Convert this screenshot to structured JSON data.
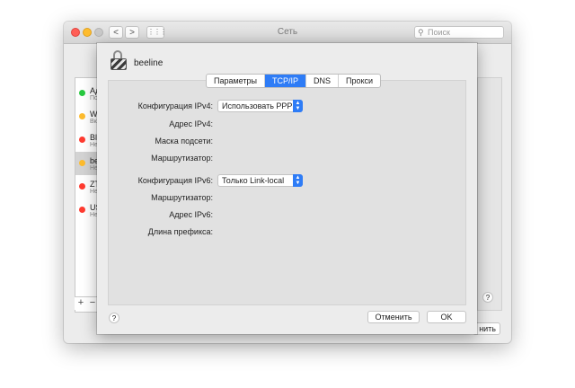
{
  "window": {
    "title": "Сеть",
    "search_placeholder": "Поиск",
    "back_glyph": "<",
    "forward_glyph": ">",
    "grid_glyph": "⋮⋮⋮",
    "help_glyph": "?",
    "apply_fragment": "нить"
  },
  "sidebar": {
    "items": [
      {
        "name": "Ад",
        "status": "По",
        "color": "#27c93f"
      },
      {
        "name": "Wi",
        "status": "Вкл",
        "color": "#febc2e"
      },
      {
        "name": "Blu",
        "status": "Не",
        "color": "#ff3b30"
      },
      {
        "name": "be",
        "status": "Не",
        "color": "#febc2e"
      },
      {
        "name": "ZT",
        "status": "Не",
        "color": "#ff3b30"
      },
      {
        "name": "US",
        "status": "Не",
        "color": "#ff3b30"
      }
    ],
    "add": "+",
    "remove": "−"
  },
  "sheet": {
    "interface_name": "beeline",
    "tabs": [
      "Параметры",
      "TCP/IP",
      "DNS",
      "Прокси"
    ],
    "active_tab": "TCP/IP",
    "ipv4": {
      "config_label": "Конфигурация IPv4:",
      "config_value": "Использовать PPP",
      "address_label": "Адрес IPv4:",
      "mask_label": "Маска подсети:",
      "router_label": "Маршрутизатор:"
    },
    "ipv6": {
      "config_label": "Конфигурация IPv6:",
      "config_value": "Только Link-local",
      "router_label": "Маршрутизатор:",
      "address_label": "Адрес IPv6:",
      "prefix_label": "Длина префикса:"
    },
    "help_glyph": "?",
    "cancel_label": "Отменить",
    "ok_label": "OK",
    "accent_color": "#2e7cf6"
  }
}
